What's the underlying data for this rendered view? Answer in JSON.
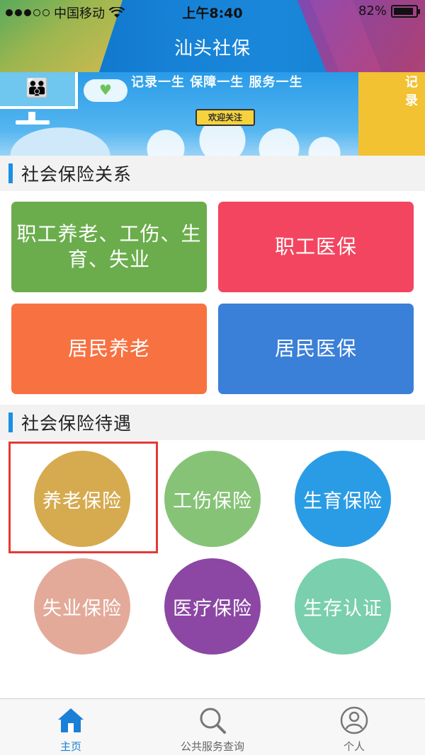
{
  "status_bar": {
    "carrier": "中国移动",
    "time": "上午8:40",
    "battery": "82%"
  },
  "header": {
    "title": "汕头社保"
  },
  "banner": {
    "slogan": "记录一生 保障一生 服务一生",
    "welcome_button": "欢迎关注",
    "side_text": "记录"
  },
  "section_relations": {
    "title": "社会保险关系",
    "tiles": [
      {
        "label": "职工养老、工伤、生育、失业",
        "color": "#6bad4c"
      },
      {
        "label": "职工医保",
        "color": "#f3455f"
      },
      {
        "label": "居民养老",
        "color": "#f87141"
      },
      {
        "label": "居民医保",
        "color": "#3a7fd8"
      }
    ]
  },
  "section_benefits": {
    "title": "社会保险待遇",
    "items": [
      {
        "label": "养老保险",
        "color": "#d6aa4f"
      },
      {
        "label": "工伤保险",
        "color": "#86c377"
      },
      {
        "label": "生育保险",
        "color": "#2a9ce5"
      },
      {
        "label": "失业保险",
        "color": "#e3aa9a"
      },
      {
        "label": "医疗保险",
        "color": "#8b47a3"
      },
      {
        "label": "生存认证",
        "color": "#79cfae"
      }
    ]
  },
  "tab_bar": {
    "tabs": [
      {
        "label": "主页",
        "icon": "home-icon",
        "active": true
      },
      {
        "label": "公共服务查询",
        "icon": "search-icon",
        "active": false
      },
      {
        "label": "个人",
        "icon": "person-icon",
        "active": false
      }
    ],
    "active_color": "#1a7fd6"
  }
}
